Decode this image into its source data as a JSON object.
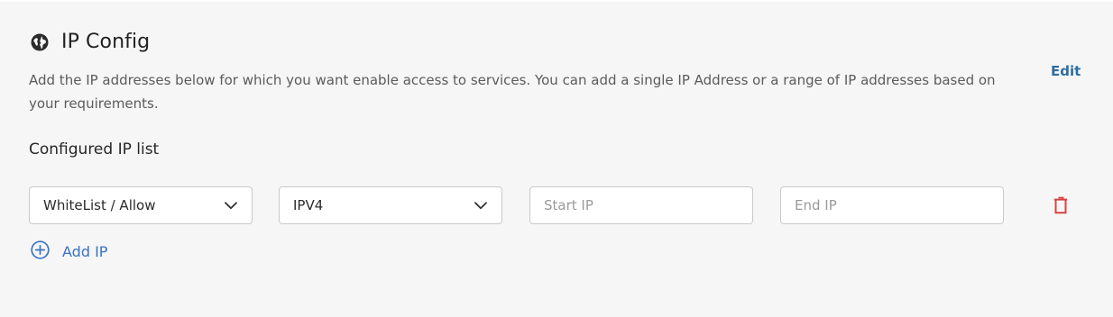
{
  "header": {
    "icon": "globe-icon",
    "title": "IP Config"
  },
  "description": "Add the IP addresses below for which you want enable access to services. You can add a single IP Address or a range of IP addresses based on your requirements.",
  "edit_label": "Edit",
  "section_label": "Configured IP list",
  "ip_row": {
    "access_type": "WhiteList / Allow",
    "ip_version": "IPV4",
    "start_ip_placeholder": "Start IP",
    "start_ip_value": "",
    "end_ip_placeholder": "End IP",
    "end_ip_value": "",
    "delete_icon": "trash-icon"
  },
  "add_ip_label": "Add IP",
  "colors": {
    "background": "#f6f6f6",
    "edit_link": "#2d6ea1",
    "add_link": "#3b73c2",
    "delete": "#d94242"
  }
}
